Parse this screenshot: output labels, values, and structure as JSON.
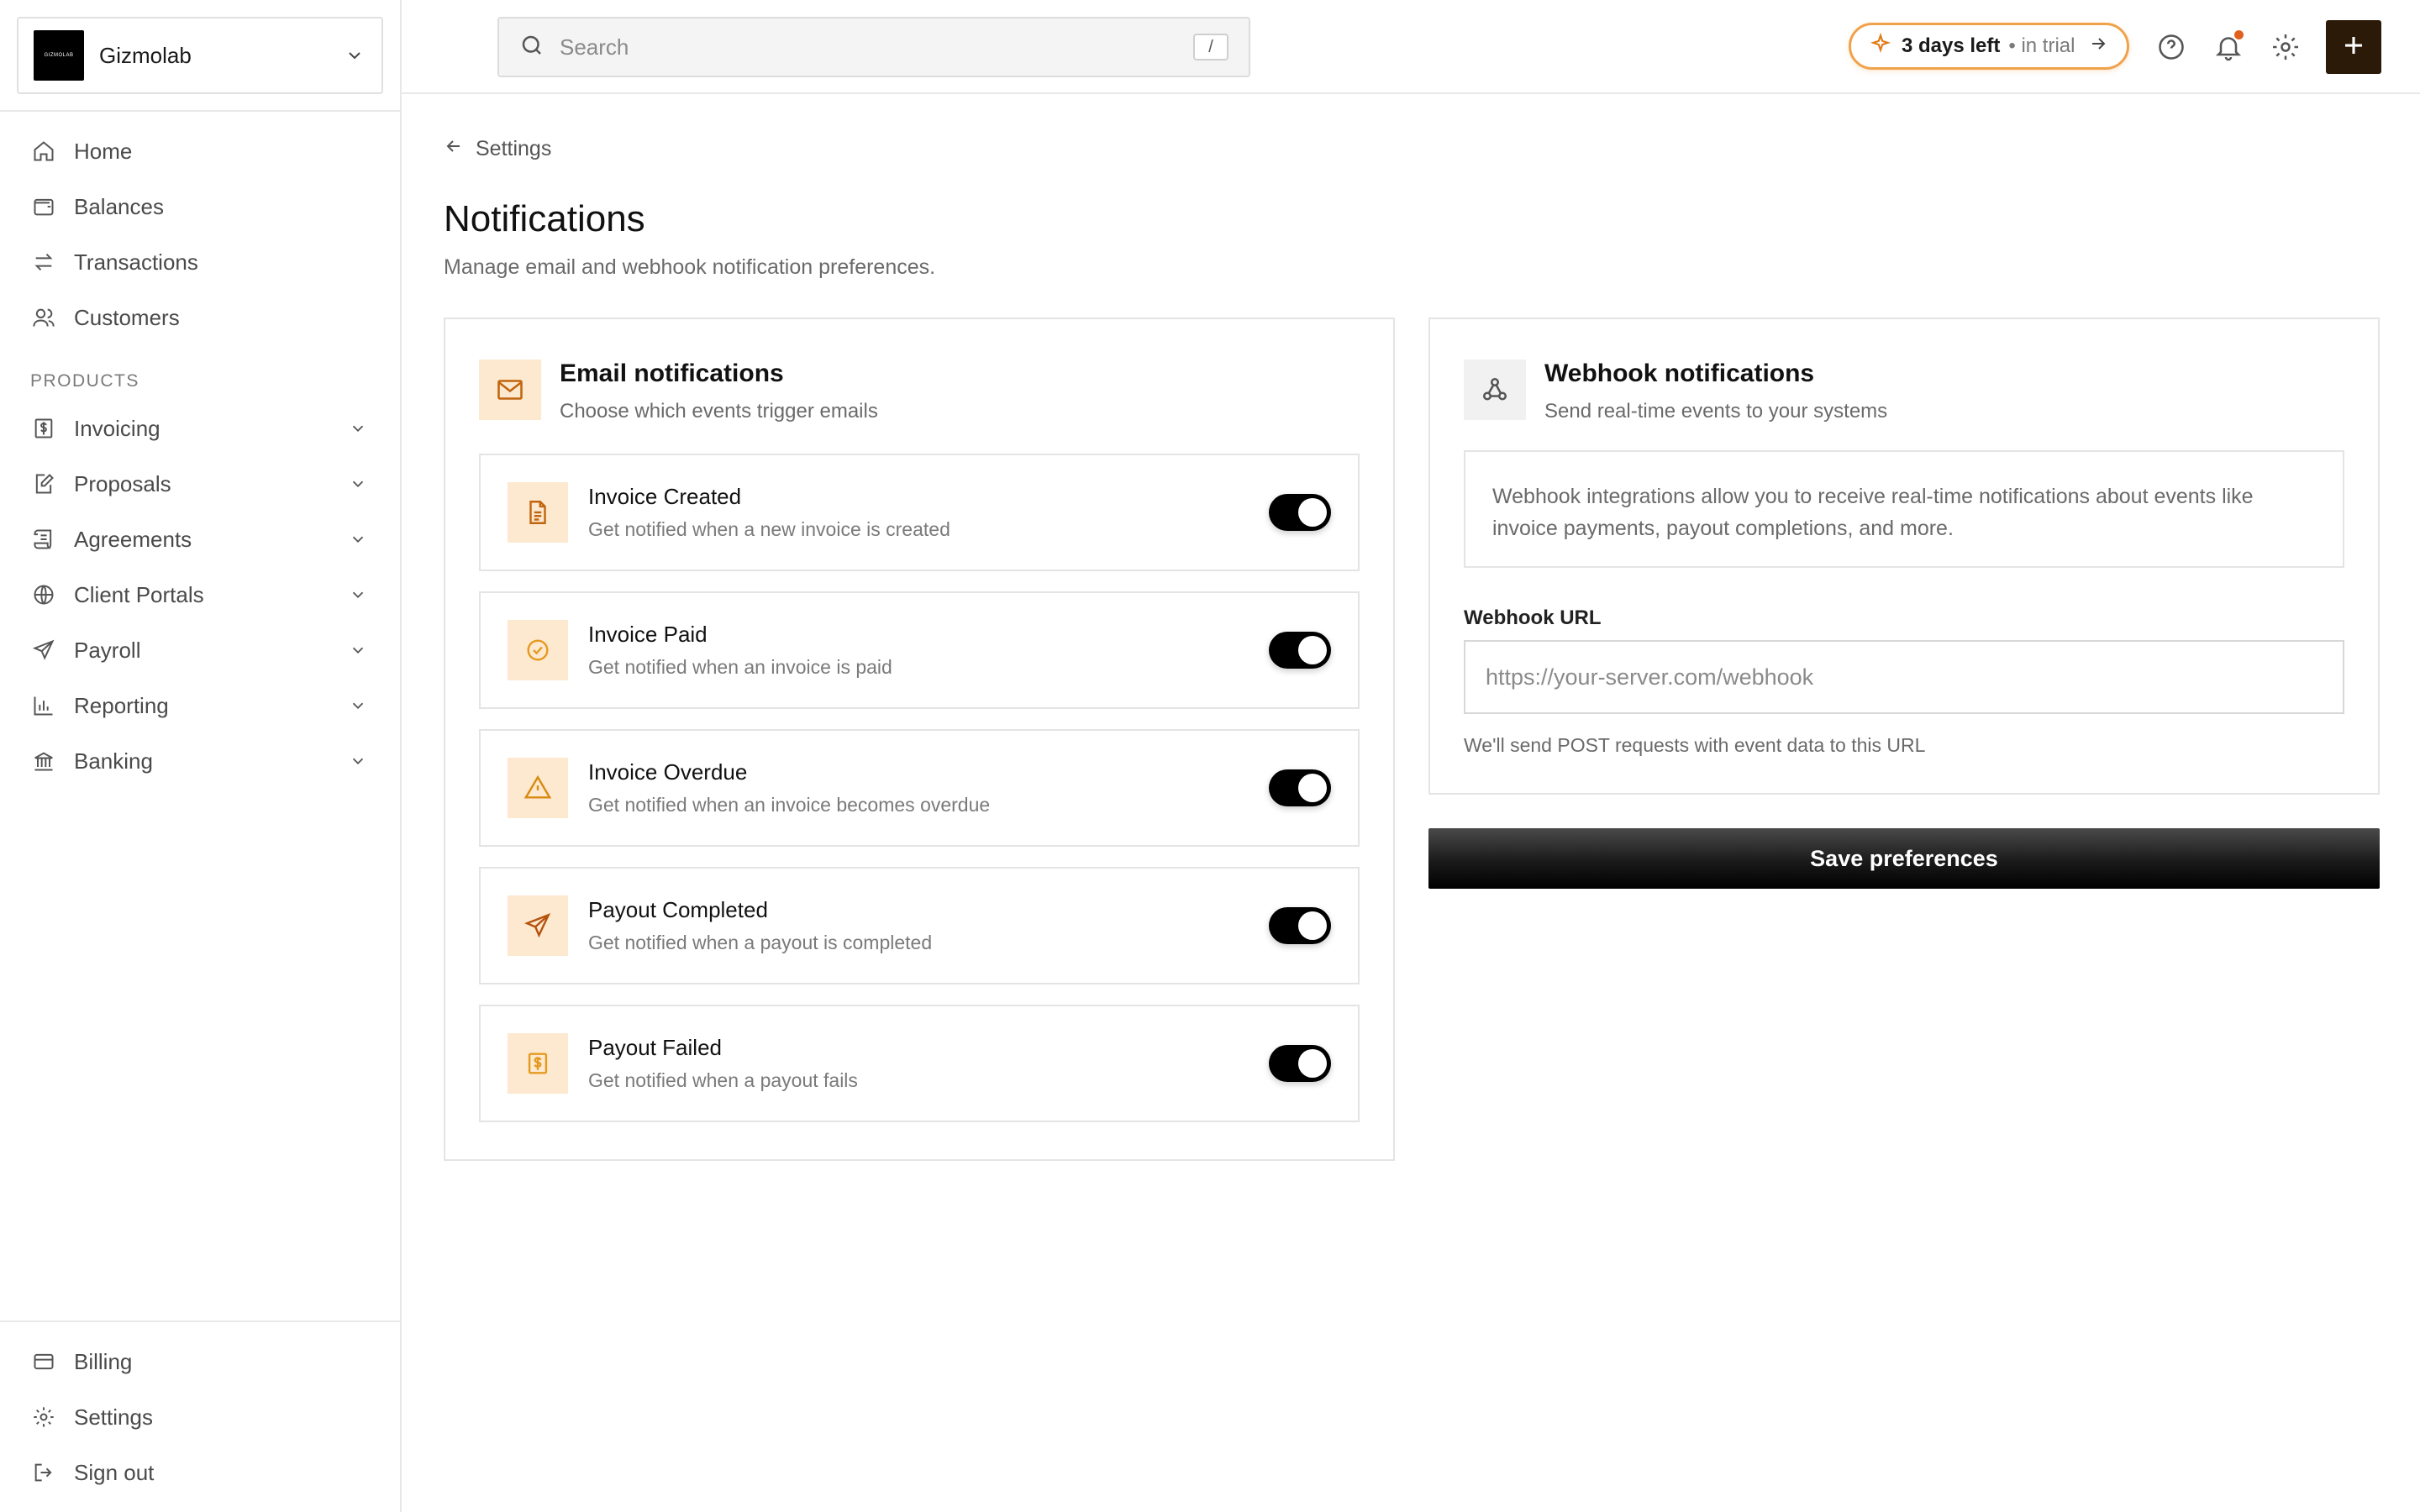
{
  "org": {
    "name": "Gizmolab",
    "logo_text": "GIZMOLAB"
  },
  "sidebar": {
    "main_items": [
      {
        "label": "Home",
        "icon": "home-icon"
      },
      {
        "label": "Balances",
        "icon": "wallet-icon"
      },
      {
        "label": "Transactions",
        "icon": "transfer-icon"
      },
      {
        "label": "Customers",
        "icon": "users-icon"
      }
    ],
    "products_label": "PRODUCTS",
    "product_items": [
      {
        "label": "Invoicing",
        "icon": "dollar-doc-icon"
      },
      {
        "label": "Proposals",
        "icon": "edit-doc-icon"
      },
      {
        "label": "Agreements",
        "icon": "scroll-icon"
      },
      {
        "label": "Client Portals",
        "icon": "globe-icon"
      },
      {
        "label": "Payroll",
        "icon": "send-icon"
      },
      {
        "label": "Reporting",
        "icon": "bar-chart-icon"
      },
      {
        "label": "Banking",
        "icon": "bank-icon"
      }
    ],
    "bottom_items": [
      {
        "label": "Billing",
        "icon": "card-icon"
      },
      {
        "label": "Settings",
        "icon": "gear-icon"
      },
      {
        "label": "Sign out",
        "icon": "sign-out-icon"
      }
    ]
  },
  "header": {
    "search_placeholder": "Search",
    "search_shortcut": "/",
    "trial_days": "3 days left",
    "trial_suffix": "• in trial"
  },
  "page": {
    "breadcrumb": "Settings",
    "title": "Notifications",
    "subtitle": "Manage email and webhook notification preferences."
  },
  "email": {
    "title": "Email notifications",
    "subtitle": "Choose which events trigger emails",
    "items": [
      {
        "title": "Invoice Created",
        "desc": "Get notified when a new invoice is created",
        "icon": "document-icon",
        "enabled": true
      },
      {
        "title": "Invoice Paid",
        "desc": "Get notified when an invoice is paid",
        "icon": "check-circle-icon",
        "enabled": true
      },
      {
        "title": "Invoice Overdue",
        "desc": "Get notified when an invoice becomes overdue",
        "icon": "warning-icon",
        "enabled": true
      },
      {
        "title": "Payout Completed",
        "desc": "Get notified when a payout is completed",
        "icon": "send-icon",
        "enabled": true
      },
      {
        "title": "Payout Failed",
        "desc": "Get notified when a payout fails",
        "icon": "dollar-alert-icon",
        "enabled": true
      }
    ]
  },
  "webhook": {
    "title": "Webhook notifications",
    "subtitle": "Send real-time events to your systems",
    "info": "Webhook integrations allow you to receive real-time notifications about events like invoice payments, payout completions, and more.",
    "url_label": "Webhook URL",
    "url_placeholder": "https://your-server.com/webhook",
    "url_value": "",
    "help": "We'll send POST requests with event data to this URL"
  },
  "save_label": "Save preferences",
  "colors": {
    "accent": "#f0a24a",
    "icon_bg": "#fde9cf",
    "icon_fg": "#e07b1a",
    "dark": "#2c1a08"
  }
}
